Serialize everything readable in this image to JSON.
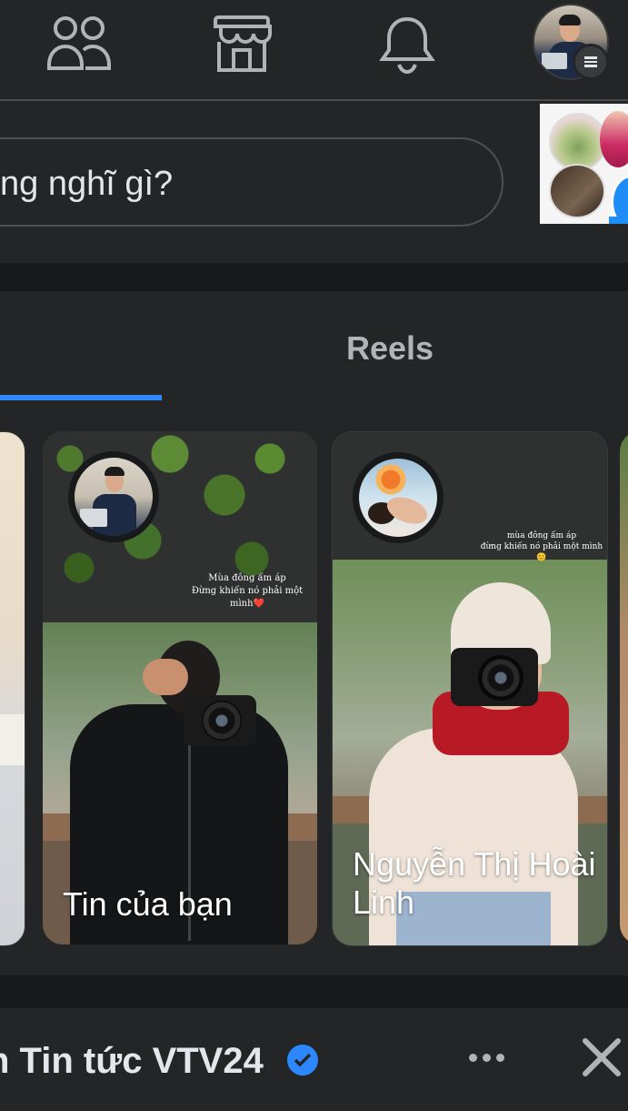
{
  "nav": {
    "icons": [
      "friends-icon",
      "marketplace-icon",
      "notifications-icon",
      "profile-avatar",
      "menu-icon"
    ]
  },
  "composer": {
    "placeholder_partial": "ng nghĩ gì?"
  },
  "stories_section": {
    "tab_reels_label": "Reels",
    "stories": [
      {
        "name": "Tin của bạn",
        "caption_line1": "Mùa đông ấm áp",
        "caption_line2": "Đừng khiến nó phải một mình❤️"
      },
      {
        "name": "Nguyễn Thị Hoài Linh",
        "caption_line1": "mùa đông ấm áp",
        "caption_line2": "đừng khiến nó phải một mình 😊"
      }
    ]
  },
  "post": {
    "title_partial": "n Tin tức VTV24",
    "colors": {
      "background": "#242526",
      "separator": "#18191a",
      "accent": "#2d88ff",
      "text": "#e4e6eb",
      "muted": "#b0b3b8"
    }
  }
}
